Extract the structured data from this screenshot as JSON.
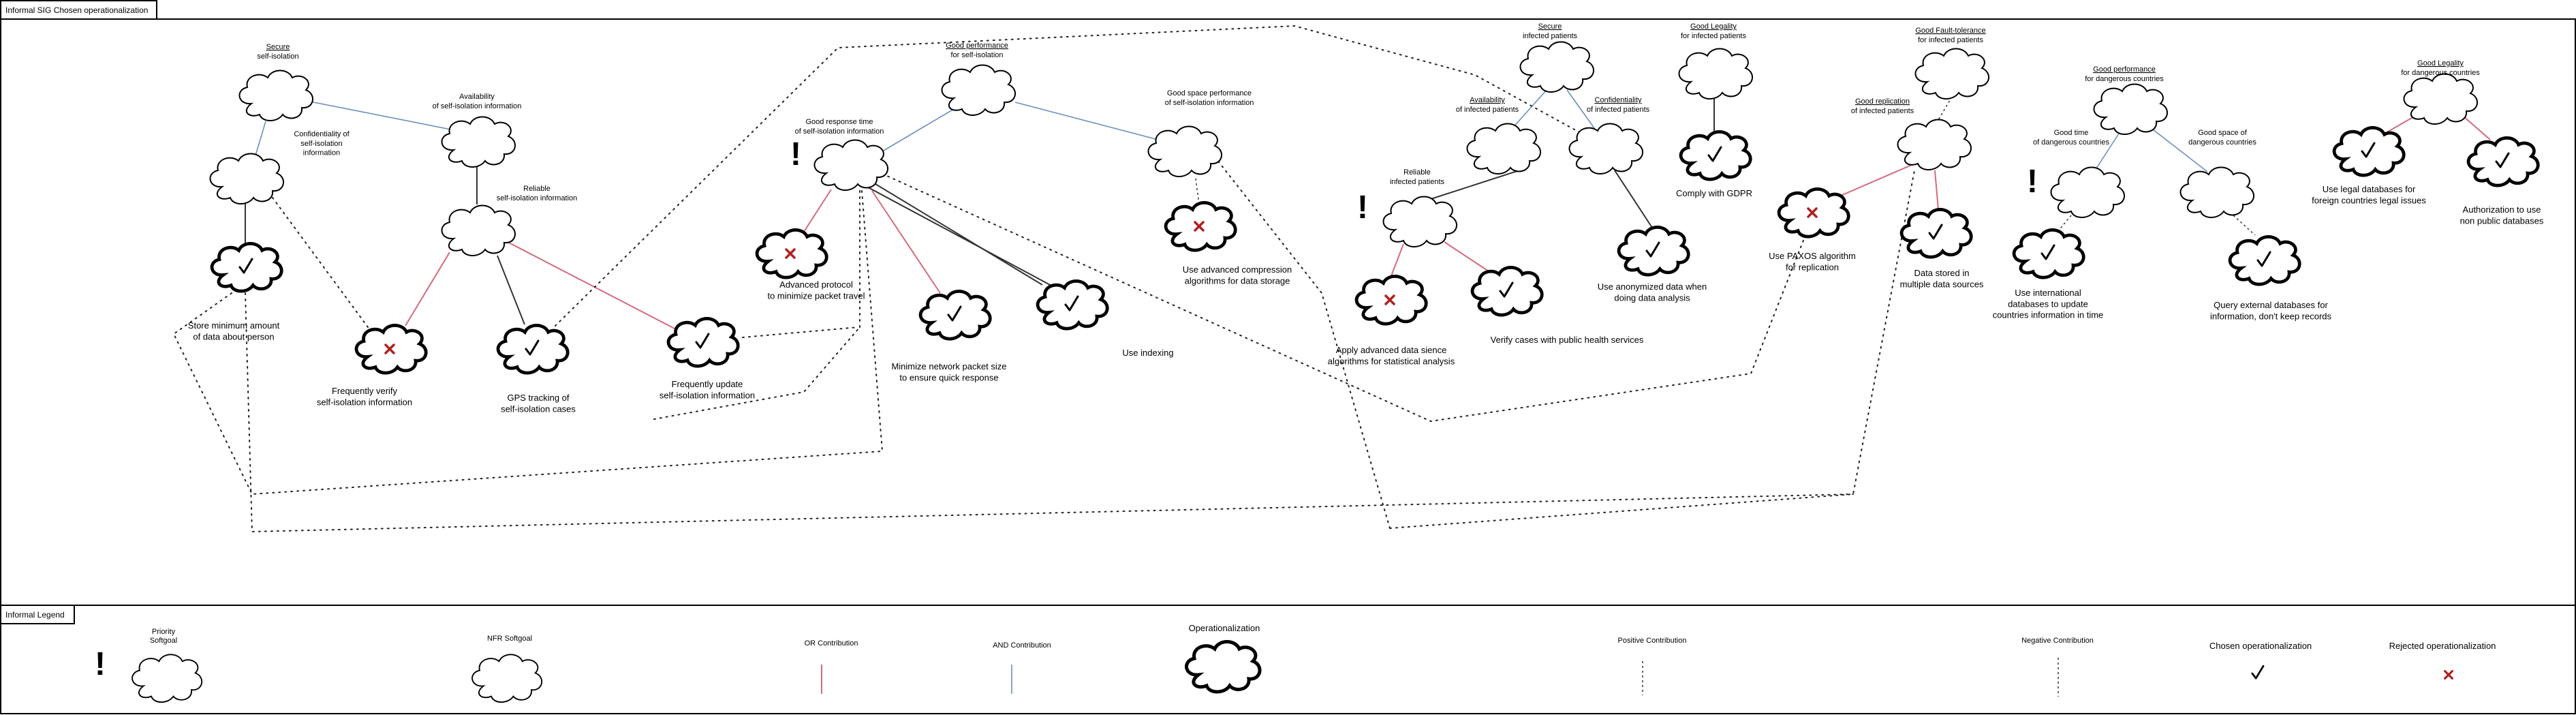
{
  "title": "Informal SIG Chosen operationalization",
  "legend_title": "Informal Legend",
  "softgoals": [
    {
      "id": "sg1",
      "label": [
        "Secure",
        "self-isolation"
      ],
      "underline": 0
    },
    {
      "id": "sg2",
      "label": [
        "Confidentiality of",
        "self-isolation",
        "information"
      ]
    },
    {
      "id": "sg3",
      "label": [
        "Availability",
        "of self-isolation information"
      ]
    },
    {
      "id": "sg4",
      "label": [
        "Reliable",
        "self-isolation information"
      ]
    },
    {
      "id": "sg5",
      "label": [
        "Good performance",
        "for self-isolation"
      ],
      "underline": 0
    },
    {
      "id": "sg6",
      "label": [
        "Good response time",
        "of self-isolation information"
      ]
    },
    {
      "id": "sg7",
      "label": [
        "Good space performance",
        "of self-isolation information"
      ]
    },
    {
      "id": "sg8",
      "label": [
        "Secure",
        "infected patients"
      ],
      "underline": 0
    },
    {
      "id": "sg9",
      "label": [
        "Availability",
        "of infected patients"
      ],
      "underline": 0
    },
    {
      "id": "sg10",
      "label": [
        "Confidentiality",
        "of infected patients"
      ],
      "underline": 0
    },
    {
      "id": "sg11",
      "label": [
        "Reliable",
        "infected patients"
      ]
    },
    {
      "id": "sg12",
      "label": [
        "Good Legality",
        "for infected patients"
      ],
      "underline": 0
    },
    {
      "id": "sg13",
      "label": [
        "Good Fault-tolerance",
        "for infected patients"
      ],
      "underline": 0
    },
    {
      "id": "sg14",
      "label": [
        "Good replication",
        "of infected patients"
      ],
      "underline": 0
    },
    {
      "id": "sg15",
      "label": [
        "Good performance",
        "for dangerous countries"
      ],
      "underline": 0
    },
    {
      "id": "sg16",
      "label": [
        "Good time",
        "of dangerous countries"
      ]
    },
    {
      "id": "sg17",
      "label": [
        "Good space of",
        "dangerous countries"
      ]
    },
    {
      "id": "sg18",
      "label": [
        "Good Legality",
        "for dangerous countries"
      ],
      "underline": 0
    }
  ],
  "operationalizations": [
    {
      "id": "op1",
      "status": "chosen",
      "label": [
        "Store minimum amount",
        "of data about person"
      ]
    },
    {
      "id": "op2",
      "status": "rejected",
      "label": [
        "Frequently verify",
        "self-isolation information"
      ]
    },
    {
      "id": "op3",
      "status": "chosen",
      "label": [
        "GPS tracking of",
        "self-isolation cases"
      ]
    },
    {
      "id": "op4",
      "status": "chosen",
      "label": [
        "Frequently update",
        "self-isolation information"
      ]
    },
    {
      "id": "op5",
      "status": "rejected",
      "label": [
        "Advanced protocol",
        "to minimize packet travel"
      ]
    },
    {
      "id": "op6",
      "status": "chosen",
      "label": [
        "Minimize network packet size",
        "to ensure quick response"
      ]
    },
    {
      "id": "op7",
      "status": "chosen",
      "label": [
        "Use indexing"
      ]
    },
    {
      "id": "op8",
      "status": "rejected",
      "label": [
        "Use advanced compression",
        "algorithms for data storage"
      ]
    },
    {
      "id": "op9",
      "status": "rejected",
      "label": [
        "Apply advanced data sience",
        "algorithms for statistical analysis"
      ]
    },
    {
      "id": "op10",
      "status": "chosen",
      "label": [
        "Verify cases with public health services"
      ]
    },
    {
      "id": "op11",
      "status": "chosen",
      "label": [
        "Use anonymized data when",
        "doing data analysis"
      ]
    },
    {
      "id": "op12",
      "status": "chosen",
      "label": [
        "Comply with GDPR"
      ]
    },
    {
      "id": "op13",
      "status": "rejected",
      "label": [
        "Use PAXOS algorithm",
        "for replication"
      ]
    },
    {
      "id": "op14",
      "status": "chosen",
      "label": [
        "Data stored in",
        "multiple data sources"
      ]
    },
    {
      "id": "op15",
      "status": "chosen",
      "label": [
        "Use international",
        "databases to update",
        "countries information in time"
      ]
    },
    {
      "id": "op16",
      "status": "chosen",
      "label": [
        "Query external databases for",
        "information, don't keep records"
      ]
    },
    {
      "id": "op17",
      "status": "chosen",
      "label": [
        "Use legal databases for",
        "foreign countries legal issues"
      ]
    },
    {
      "id": "op18",
      "status": "chosen",
      "label": [
        "Authorization to use",
        "non public databases"
      ]
    }
  ],
  "priority_marks": [
    "!",
    "!",
    "!",
    "!"
  ],
  "legend": {
    "priority_softgoal": [
      "Priority",
      "Softgoal"
    ],
    "nfr_softgoal": "NFR Softgoal",
    "or_contribution": "OR Contribution",
    "and_contribution": "AND Contribution",
    "operationalization": "Operationalization",
    "positive_contribution": "Positive Contribution",
    "negative_contribution": "Negative Contribution",
    "chosen_operationalization": "Chosen operationalization",
    "rejected_operationalization": "Rejected operationalization",
    "priority_mark": "!"
  },
  "contribution_signs": {
    "plus": "+",
    "minus": "-"
  },
  "colors": {
    "or": "#d46a7e",
    "and": "#6c8ebf",
    "rejected": "#b02020",
    "frame": "#000000"
  }
}
